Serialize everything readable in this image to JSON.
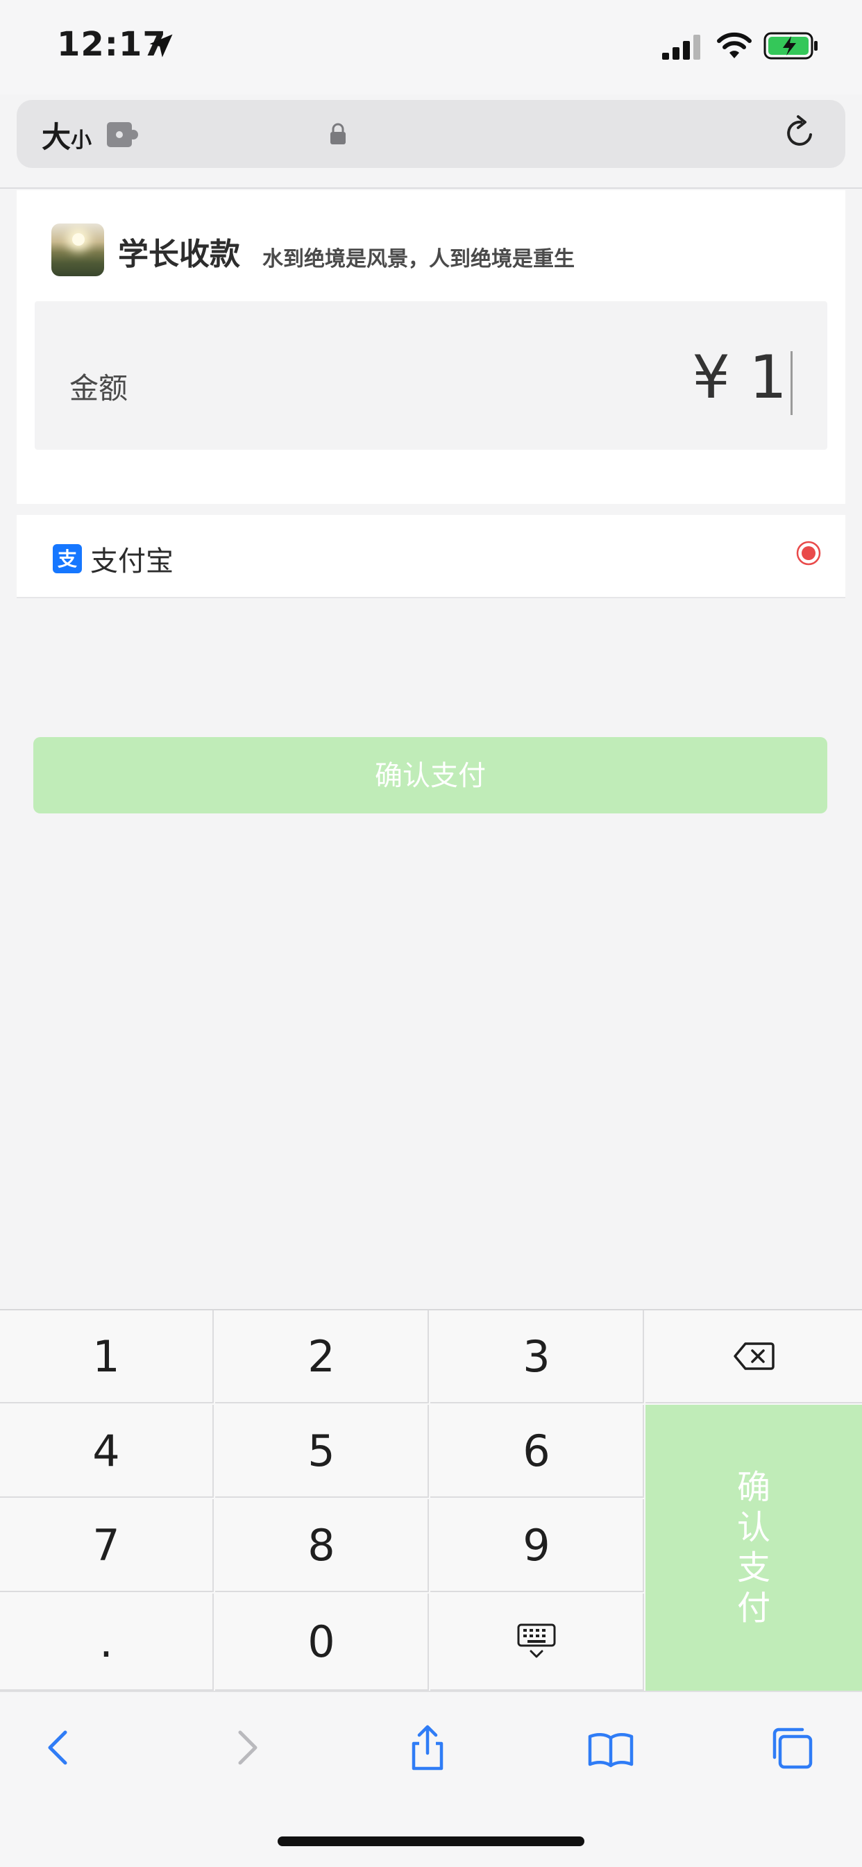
{
  "status_bar": {
    "time": "12:17",
    "accent_battery": "#34c759"
  },
  "url_bar": {
    "text_size_label_big": "大",
    "text_size_label_small": "小"
  },
  "merchant": {
    "name": "学长收款",
    "slogan": "水到绝境是风景，人到绝境是重生"
  },
  "amount": {
    "label": "金额",
    "value": "¥ 1"
  },
  "payment_method": {
    "label": "支付宝",
    "selected": true,
    "brand_color": "#1677ff",
    "radio_color": "#e94a4a"
  },
  "confirm_button": {
    "label": "确认支付",
    "color": "#c0ecb8"
  },
  "keypad": {
    "keys": [
      "1",
      "2",
      "3",
      "4",
      "5",
      "6",
      "7",
      "8",
      "9",
      ".",
      "0"
    ],
    "confirm_chars": [
      "确",
      "认",
      "支",
      "付"
    ]
  }
}
